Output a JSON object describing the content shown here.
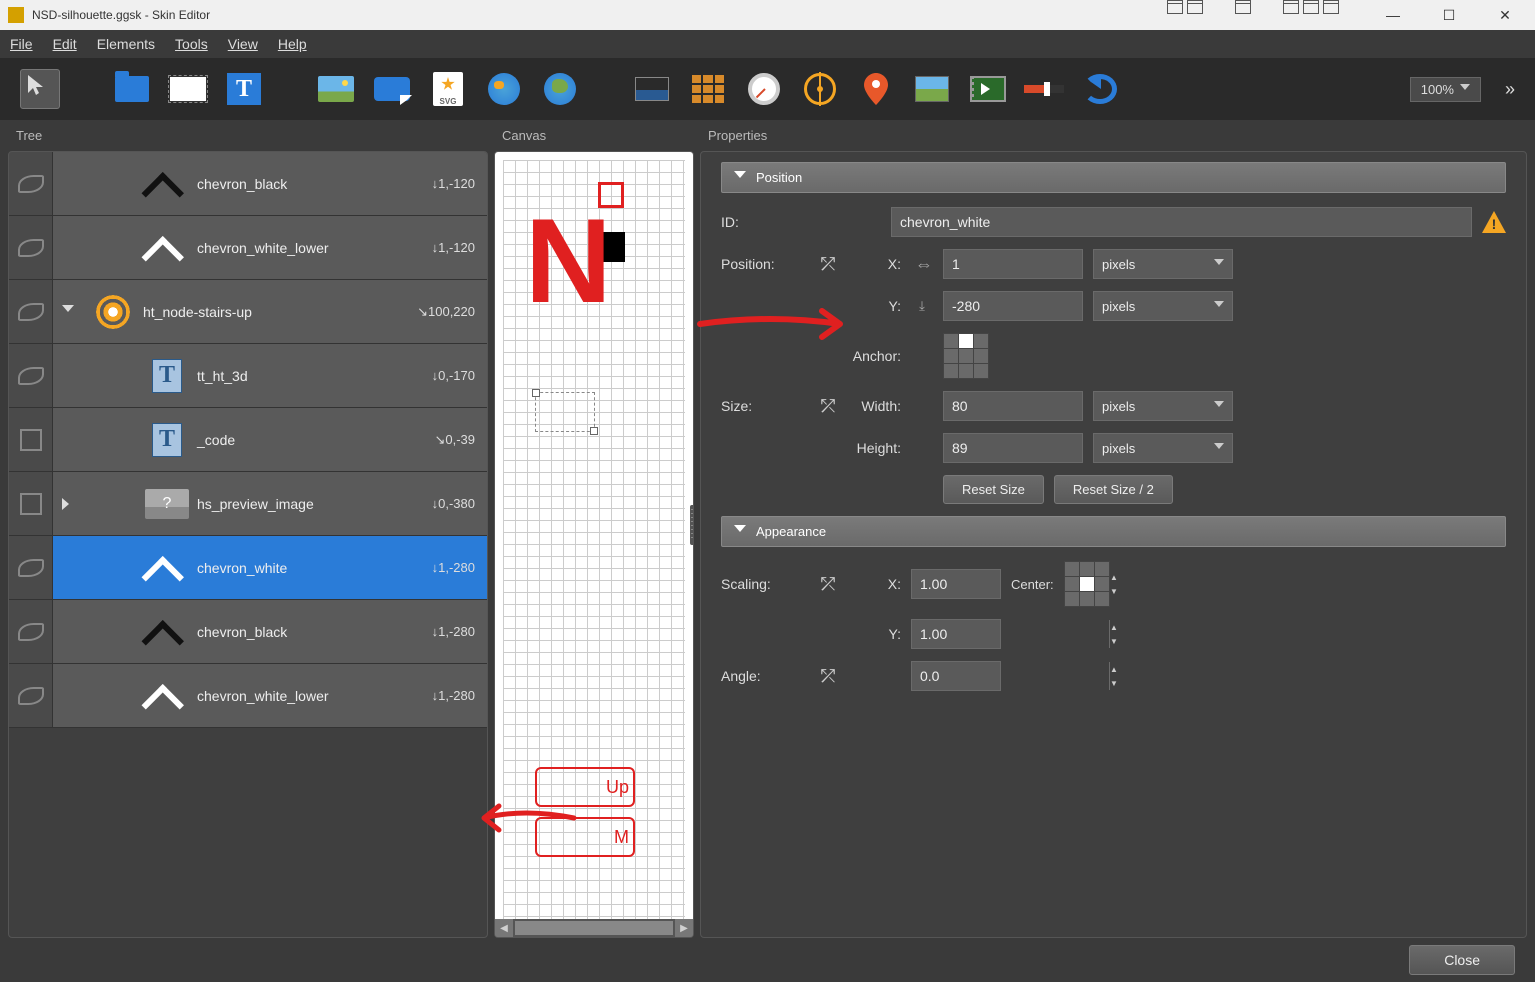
{
  "window": {
    "title": "NSD-silhouette.ggsk - Skin Editor"
  },
  "menu": {
    "file": "File",
    "edit": "Edit",
    "elements": "Elements",
    "tools": "Tools",
    "view": "View",
    "help": "Help"
  },
  "toolbar": {
    "zoom": "100%",
    "svg_label": "SVG"
  },
  "panels": {
    "tree": "Tree",
    "canvas": "Canvas",
    "properties": "Properties"
  },
  "tree": {
    "items": [
      {
        "label": "chevron_black",
        "coords": "↓1,-120",
        "indent": 2,
        "icon": "chev-black",
        "vis": "on"
      },
      {
        "label": "chevron_white_lower",
        "coords": "↓1,-120",
        "indent": 2,
        "icon": "chev-white",
        "vis": "on"
      },
      {
        "label": "ht_node-stairs-up",
        "coords": "↘100,220",
        "indent": 1,
        "icon": "target",
        "vis": "on",
        "expanded": true
      },
      {
        "label": "tt_ht_3d",
        "coords": "↓0,-170",
        "indent": 2,
        "icon": "text",
        "vis": "on"
      },
      {
        "label": "_code",
        "coords": "↘0,-39",
        "indent": 2,
        "icon": "text",
        "vis": "off"
      },
      {
        "label": "hs_preview_image",
        "coords": "↓0,-380",
        "indent": 2,
        "icon": "img",
        "vis": "off",
        "expandable": true
      },
      {
        "label": "chevron_white",
        "coords": "↓1,-280",
        "indent": 2,
        "icon": "chev-white",
        "vis": "on",
        "selected": true
      },
      {
        "label": "chevron_black",
        "coords": "↓1,-280",
        "indent": 2,
        "icon": "chev-black",
        "vis": "on"
      },
      {
        "label": "chevron_white_lower",
        "coords": "↓1,-280",
        "indent": 2,
        "icon": "chev-white",
        "vis": "on"
      }
    ]
  },
  "canvas": {
    "letter": "N",
    "box1": "Up",
    "box2": "M"
  },
  "props": {
    "sections": {
      "position": "Position",
      "appearance": "Appearance"
    },
    "id_label": "ID:",
    "id_value": "chevron_white",
    "position_label": "Position:",
    "x_label": "X:",
    "x_value": "1",
    "x_unit": "pixels",
    "y_label": "Y:",
    "y_value": "-280",
    "y_unit": "pixels",
    "anchor_label": "Anchor:",
    "size_label": "Size:",
    "width_label": "Width:",
    "width_value": "80",
    "width_unit": "pixels",
    "height_label": "Height:",
    "height_value": "89",
    "height_unit": "pixels",
    "reset_size": "Reset Size",
    "reset_size2": "Reset Size / 2",
    "scaling_label": "Scaling:",
    "sx_value": "1.00",
    "sy_value": "1.00",
    "center_label": "Center:",
    "angle_label": "Angle:",
    "angle_value": "0.0"
  },
  "footer": {
    "close": "Close"
  }
}
